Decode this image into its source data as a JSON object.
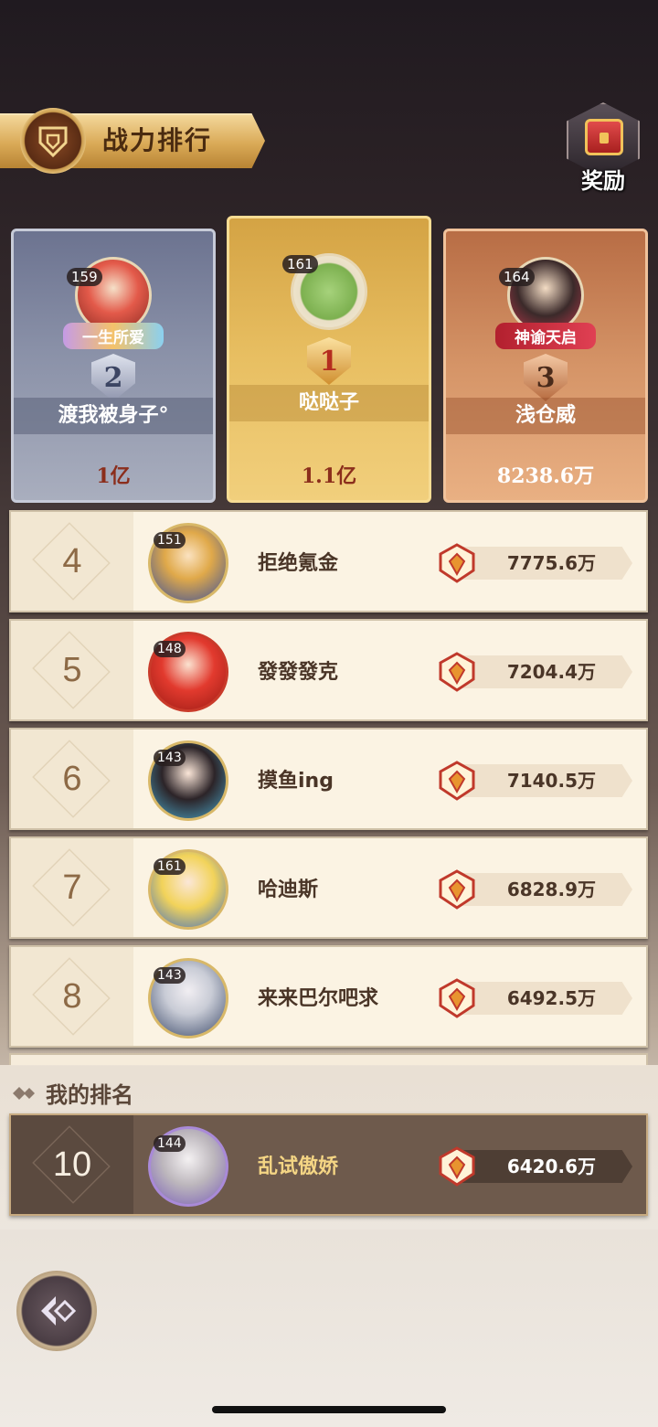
{
  "header": {
    "title": "战力排行",
    "reward_label": "奖励"
  },
  "top3": [
    {
      "rank": "2",
      "level": "159",
      "name": "渡我被身子°",
      "power": "1亿",
      "tag": "一生所爱"
    },
    {
      "rank": "1",
      "level": "161",
      "name": "哒哒子",
      "power": "1.1亿",
      "tag": ""
    },
    {
      "rank": "3",
      "level": "164",
      "name": "浅仓威",
      "power": "8238.6万",
      "tag": "神谕天启"
    }
  ],
  "list": [
    {
      "rank": "4",
      "level": "151",
      "name": "拒绝氪金",
      "power": "7775.6万"
    },
    {
      "rank": "5",
      "level": "148",
      "name": "發發發克",
      "power": "7204.4万"
    },
    {
      "rank": "6",
      "level": "143",
      "name": "摸鱼ing",
      "power": "7140.5万"
    },
    {
      "rank": "7",
      "level": "161",
      "name": "哈迪斯",
      "power": "6828.9万"
    },
    {
      "rank": "8",
      "level": "143",
      "name": "来来巴尔吧求",
      "power": "6492.5万"
    }
  ],
  "my_ranking": {
    "title": "我的排名",
    "rank": "10",
    "level": "144",
    "name": "乱试傲娇",
    "power": "6420.6万"
  },
  "colors": {
    "gold": "#e8bf62",
    "silver": "#8a91a8",
    "bronze": "#d59467",
    "accent": "#c0392b"
  },
  "icons": [
    "shield-emblem-icon",
    "treasure-chest-icon",
    "power-icon",
    "back-arrow-icon",
    "diamond-bullet-icon"
  ]
}
